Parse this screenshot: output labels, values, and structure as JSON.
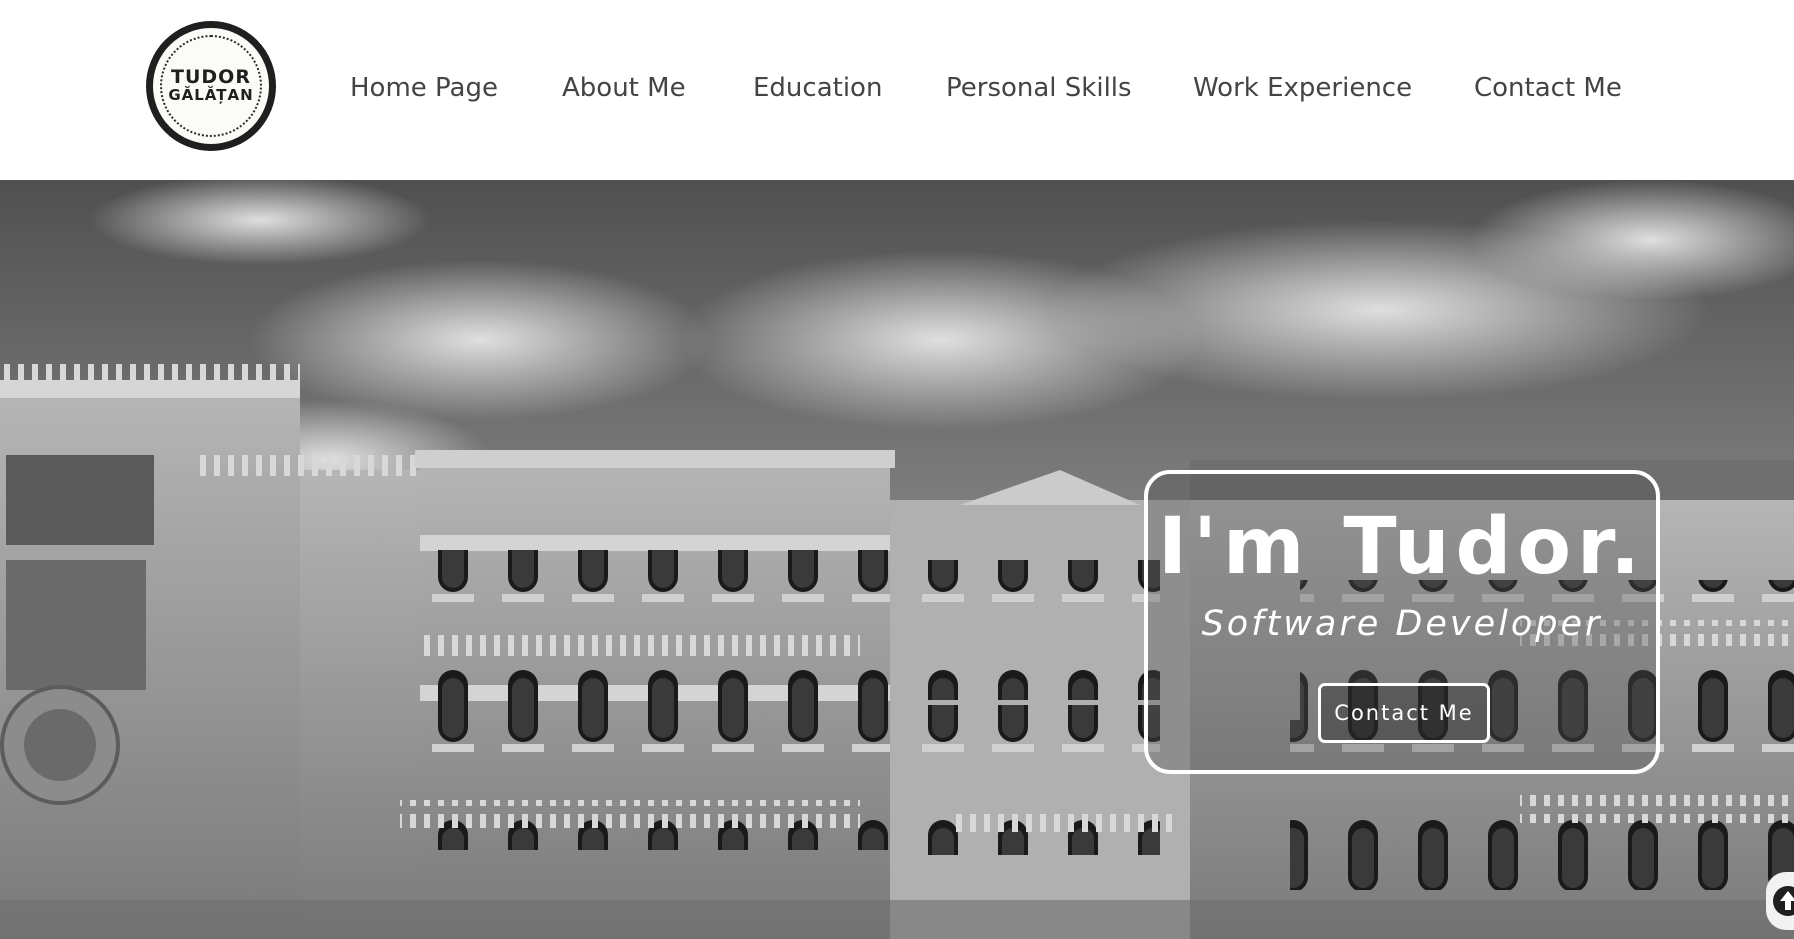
{
  "logo": {
    "line1": "TUDOR",
    "line2": "GĂLĂȚAN"
  },
  "nav": {
    "items": [
      {
        "label": "Home Page"
      },
      {
        "label": "About Me"
      },
      {
        "label": "Education"
      },
      {
        "label": "Personal Skills"
      },
      {
        "label": "Work Experience"
      },
      {
        "label": "Contact Me"
      }
    ]
  },
  "hero": {
    "title": "I'm Tudor.",
    "subtitle": "Software Developer",
    "button_label": "Contact Me"
  },
  "icons": {
    "scroll_top": "arrow-up-icon"
  },
  "colors": {
    "nav_text": "#444444",
    "logo_border": "#1f1f1f",
    "hero_text": "#ffffff"
  }
}
